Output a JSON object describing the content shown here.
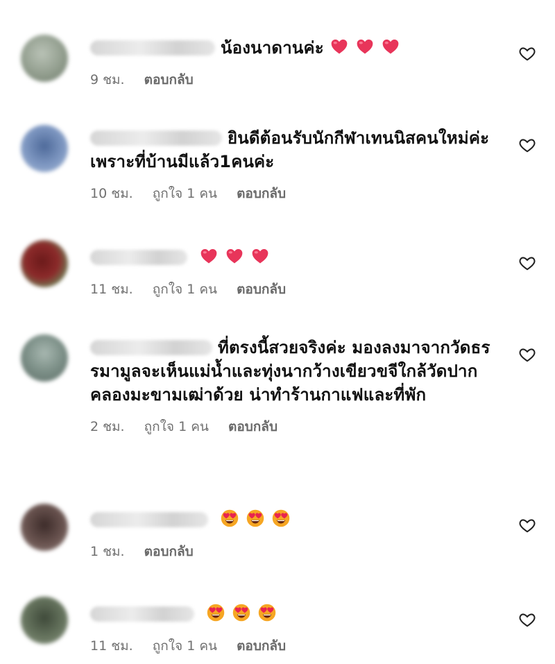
{
  "comments": [
    {
      "text": "น้องนาดานค่ะ",
      "emojis": [
        "red-heart",
        "red-heart",
        "red-heart"
      ],
      "time": "9 ชม.",
      "likes": "",
      "reply": "ตอบกลับ"
    },
    {
      "text": "ยินดีต้อนรับนักกีฬาเทนนิสคนใหม่ค่ะ เพราะที่บ้านมีแล้ว1คนค่ะ",
      "emojis": [],
      "time": "10 ชม.",
      "likes": "ถูกใจ 1 คน",
      "reply": "ตอบกลับ"
    },
    {
      "text": "",
      "emojis": [
        "red-heart",
        "red-heart",
        "red-heart"
      ],
      "time": "11 ชม.",
      "likes": "ถูกใจ 1 คน",
      "reply": "ตอบกลับ"
    },
    {
      "text": "ที่ตรงนี้สวยจริงค่ะ มองลงมาจากวัดธรรมามูลจะเห็นแม่น้ำและทุ่งนากว้างเขียวขจีใกล้วัดปากคลองมะขามเฒ่าด้วย น่าทำร้านกาแฟและที่พัก",
      "emojis": [],
      "time": "2 ชม.",
      "likes": "ถูกใจ 1 คน",
      "reply": "ตอบกลับ"
    },
    {
      "text": "",
      "emojis": [
        "heart-eyes",
        "heart-eyes",
        "heart-eyes"
      ],
      "time": "1 ชม.",
      "likes": "",
      "reply": "ตอบกลับ"
    },
    {
      "text": "",
      "emojis": [
        "heart-eyes",
        "heart-eyes",
        "heart-eyes"
      ],
      "time": "11 ชม.",
      "likes": "ถูกใจ 1 คน",
      "reply": "ตอบกลับ"
    }
  ],
  "colors": {
    "meta_text": "#707070",
    "heart_emoji": "#e8355a",
    "face_emoji": "#f6a623"
  },
  "icons": {
    "like": "heart-outline-icon"
  }
}
